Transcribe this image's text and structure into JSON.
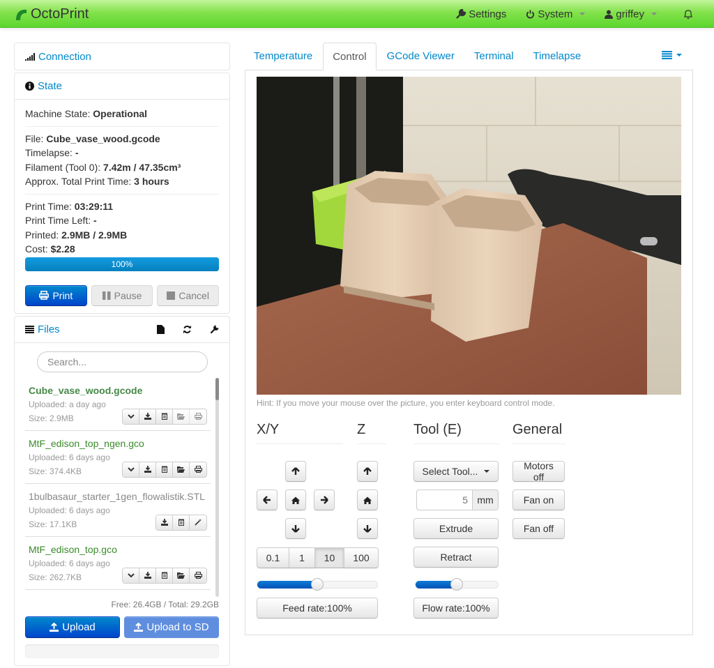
{
  "navbar": {
    "brand": "OctoPrint",
    "settings": "Settings",
    "system": "System",
    "user": "griffey"
  },
  "sidebar": {
    "connection": {
      "title": "Connection"
    },
    "state": {
      "title": "State",
      "machine_state_label": "Machine State: ",
      "machine_state": "Operational",
      "file_label": "File: ",
      "file": "Cube_vase_wood.gcode",
      "timelapse_label": "Timelapse: ",
      "timelapse": "-",
      "filament_label": "Filament (Tool 0): ",
      "filament": "7.42m / 47.35cm³",
      "approx_label": "Approx. Total Print Time: ",
      "approx": "3 hours",
      "print_time_label": "Print Time: ",
      "print_time": "03:29:11",
      "time_left_label": "Print Time Left: ",
      "time_left": "-",
      "printed_label": "Printed: ",
      "printed": "2.9MB / 2.9MB",
      "cost_label": "Cost: ",
      "cost": "$2.28",
      "progress_percent": 100,
      "progress_label": "100%",
      "buttons": {
        "print": "Print",
        "pause": "Pause",
        "cancel": "Cancel"
      }
    },
    "files": {
      "title": "Files",
      "search_placeholder": "Search...",
      "items": [
        {
          "name": "Cube_vase_wood.gcode",
          "uploaded": "Uploaded: a day ago",
          "size": "Size: 2.9MB"
        },
        {
          "name": "MtF_edison_top_ngen.gco",
          "uploaded": "Uploaded: 6 days ago",
          "size": "Size: 374.4KB"
        },
        {
          "name": "1bulbasaur_starter_1gen_flowalistik.STL",
          "uploaded": "Uploaded: 6 days ago",
          "size": "Size: 17.1KB"
        },
        {
          "name": "MtF_edison_top.gco",
          "uploaded": "Uploaded: 6 days ago",
          "size": "Size: 262.7KB"
        }
      ],
      "free_space": "Free: 26.4GB / Total: 29.2GB",
      "upload": "Upload",
      "upload_sd": "Upload to SD"
    }
  },
  "main": {
    "tabs": [
      "Temperature",
      "Control",
      "GCode Viewer",
      "Terminal",
      "Timelapse"
    ],
    "active_tab": "Control",
    "hint": "Hint: If you move your mouse over the picture, you enter keyboard control mode.",
    "control": {
      "xy_title": "X/Y",
      "z_title": "Z",
      "tool_title": "Tool (E)",
      "general_title": "General",
      "steps": [
        "0.1",
        "1",
        "10",
        "100"
      ],
      "active_step": "10",
      "feed_rate_percent": 50,
      "feed_rate_label": "Feed rate:100%",
      "select_tool": "Select Tool...",
      "extrude_amount": "5",
      "extrude_unit": "mm",
      "extrude": "Extrude",
      "retract": "Retract",
      "flow_rate_percent": 50,
      "flow_rate_label": "Flow rate:100%",
      "motors_off": "Motors off",
      "fan_on": "Fan on",
      "fan_off": "Fan off"
    }
  },
  "colors": {
    "navbar_green": "#5cd62e",
    "link_blue": "#0088cc",
    "primary_blue": "#0044cc",
    "file_green": "#468847"
  }
}
